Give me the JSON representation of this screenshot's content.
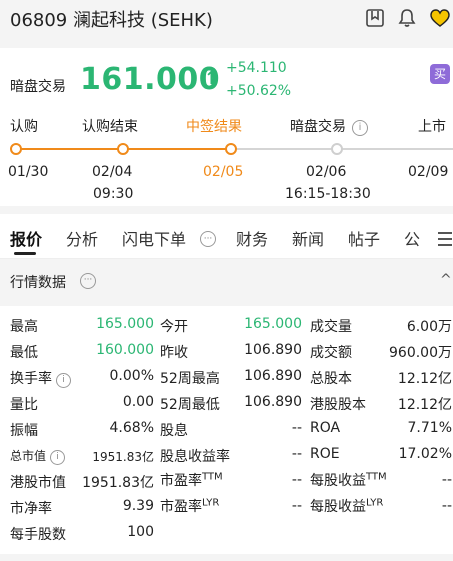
{
  "header": {
    "title": "06809 澜起科技 (SEHK)",
    "icons": [
      "bookmark-icon",
      "bell-icon",
      "heart-icon"
    ]
  },
  "quote": {
    "label": "暗盘交易",
    "price": "161.000",
    "arrow": "↑",
    "change": "+54.110",
    "change_pct": "+50.62%",
    "badge": "买"
  },
  "timeline": {
    "steps": [
      {
        "label": "认购",
        "date": "01/30",
        "time": ""
      },
      {
        "label": "认购结束",
        "date": "02/04",
        "time": "09:30"
      },
      {
        "label": "中签结果",
        "date": "02/05",
        "time": ""
      },
      {
        "label": "暗盘交易",
        "date": "02/06",
        "time": "16:15-18:30"
      },
      {
        "label": "上市",
        "date": "02/09",
        "time": ""
      }
    ],
    "info_icon": "i"
  },
  "tabs": {
    "items": [
      "报价",
      "分析",
      "闪电下单",
      "财务",
      "新闻",
      "帖子",
      "公"
    ],
    "more_icon": "···"
  },
  "section": {
    "title": "行情数据",
    "more_icon": "···",
    "collapse_icon": "^"
  },
  "stats": {
    "rows": [
      {
        "l1": "最高",
        "v1": "165.000",
        "l2": "今开",
        "v2": "165.000",
        "l3": "成交量",
        "v3": "6.00万"
      },
      {
        "l1": "最低",
        "v1": "160.000",
        "l2": "昨收",
        "v2": "106.890",
        "l3": "成交额",
        "v3": "960.00万"
      },
      {
        "l1": "换手率",
        "v1": "0.00%",
        "l2": "52周最高",
        "v2": "106.890",
        "l3": "总股本",
        "v3": "12.12亿"
      },
      {
        "l1": "量比",
        "v1": "0.00",
        "l2": "52周最低",
        "v2": "106.890",
        "l3": "港股股本",
        "v3": "12.12亿"
      },
      {
        "l1": "振幅",
        "v1": "4.68%",
        "l2": "股息",
        "v2": "--",
        "l3": "ROA",
        "v3": "7.71%"
      },
      {
        "l1": "总市值",
        "v1": "1951.83亿",
        "l2": "股息收益率",
        "v2": "--",
        "l3": "ROE",
        "v3": "17.02%"
      },
      {
        "l1": "港股市值",
        "v1": "1951.83亿",
        "l2": "市盈率",
        "l2sup": "TTM",
        "v2": "--",
        "l3": "每股收益",
        "l3sup": "TTM",
        "v3": "--"
      },
      {
        "l1": "市净率",
        "v1": "9.39",
        "l2": "市盈率",
        "l2sup": "LYR",
        "v2": "--",
        "l3": "每股收益",
        "l3sup": "LYR",
        "v3": "--"
      },
      {
        "l1": "每手股数",
        "v1": "100"
      }
    ]
  }
}
